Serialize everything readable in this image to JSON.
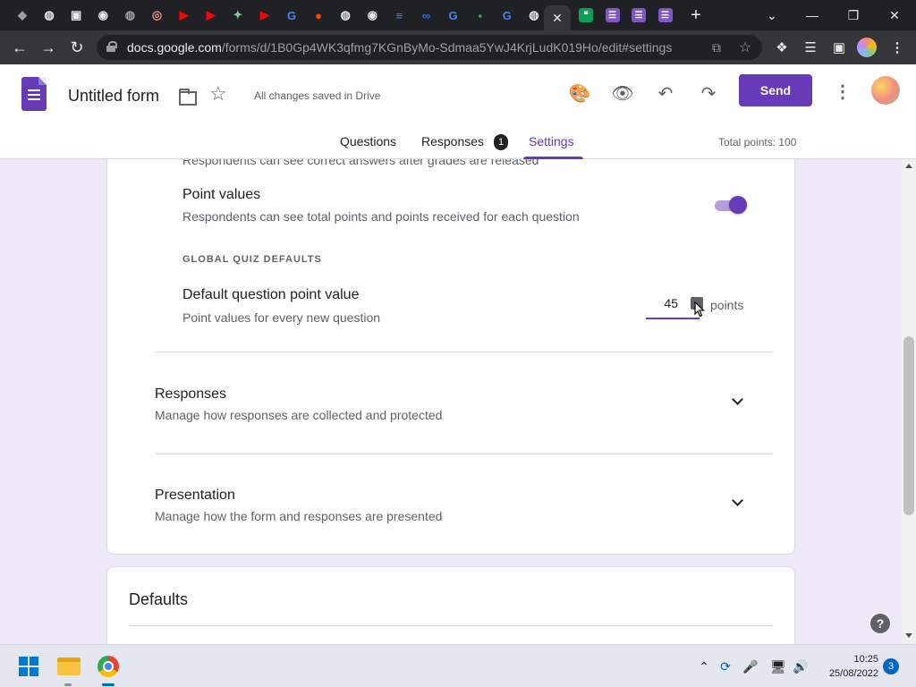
{
  "browser": {
    "tabs": [
      {
        "icon": "gray-app-icon",
        "color": "#9aa0a6"
      },
      {
        "icon": "globe-icon",
        "color": "#e8eaed"
      },
      {
        "icon": "bookmark-app-icon",
        "color": "#e8eaed"
      },
      {
        "icon": "chrome-icon",
        "color": "#e8eaed"
      },
      {
        "icon": "globe-icon",
        "color": "#9aa0a6"
      },
      {
        "icon": "record-icon",
        "color": "#f28b82"
      },
      {
        "icon": "youtube-icon",
        "color": "#ff0000"
      },
      {
        "icon": "youtube-icon",
        "color": "#ff0000"
      },
      {
        "icon": "app-icon",
        "color": "#81c995"
      },
      {
        "icon": "youtube-icon",
        "color": "#ff0000"
      },
      {
        "icon": "google-icon",
        "color": "#4285f4"
      },
      {
        "icon": "reddit-icon",
        "color": "#ff4500"
      },
      {
        "icon": "globe-icon",
        "color": "#e8eaed"
      },
      {
        "icon": "chrome-icon",
        "color": "#e8eaed"
      },
      {
        "icon": "docs-icon",
        "color": "#4285f4"
      },
      {
        "icon": "infinity-icon",
        "color": "#1a73e8"
      },
      {
        "icon": "google-icon",
        "color": "#4285f4"
      },
      {
        "icon": "chat-icon",
        "color": "#34a853"
      },
      {
        "icon": "google-icon",
        "color": "#4285f4"
      },
      {
        "icon": "globe-icon",
        "color": "#e8eaed"
      }
    ],
    "active_tab_close": "✕",
    "tabs_after": [
      {
        "icon": "hangouts-icon",
        "color": "#0f9d58"
      },
      {
        "icon": "forms-icon",
        "color": "#7e57c2"
      },
      {
        "icon": "forms-icon",
        "color": "#7e57c2"
      },
      {
        "icon": "forms-icon",
        "color": "#7e57c2"
      }
    ],
    "new_tab": "+",
    "url_host": "docs.google.com",
    "url_path": "/forms/d/1B0Gp4WK3qfmg7KGnByMo-Sdmaa5YwJ4KrjLudK019Ho/edit#settings"
  },
  "form": {
    "title": "Untitled form",
    "saved_status": "All changes saved in Drive",
    "send_label": "Send",
    "tabs": {
      "questions": "Questions",
      "responses": "Responses",
      "settings": "Settings"
    },
    "responses_count": "1",
    "total_points": "Total points: 100",
    "accent": "#673ab7"
  },
  "quiz": {
    "cut_off_text": "Respondents can see correct answers after grades are released",
    "point_values": {
      "title": "Point values",
      "description": "Respondents can see total points and points received for each question",
      "enabled": true
    },
    "global_defaults_label": "GLOBAL QUIZ DEFAULTS",
    "default_points": {
      "title": "Default question point value",
      "description": "Point values for every new question",
      "value": "45",
      "unit": "points"
    }
  },
  "sections": {
    "responses": {
      "title": "Responses",
      "description": "Manage how responses are collected and protected"
    },
    "presentation": {
      "title": "Presentation",
      "description": "Manage how the form and responses are presented"
    }
  },
  "defaults_card": {
    "title": "Defaults"
  },
  "help": "?",
  "taskbar": {
    "time": "10:25",
    "date": "25/08/2022",
    "notifications": "3"
  }
}
